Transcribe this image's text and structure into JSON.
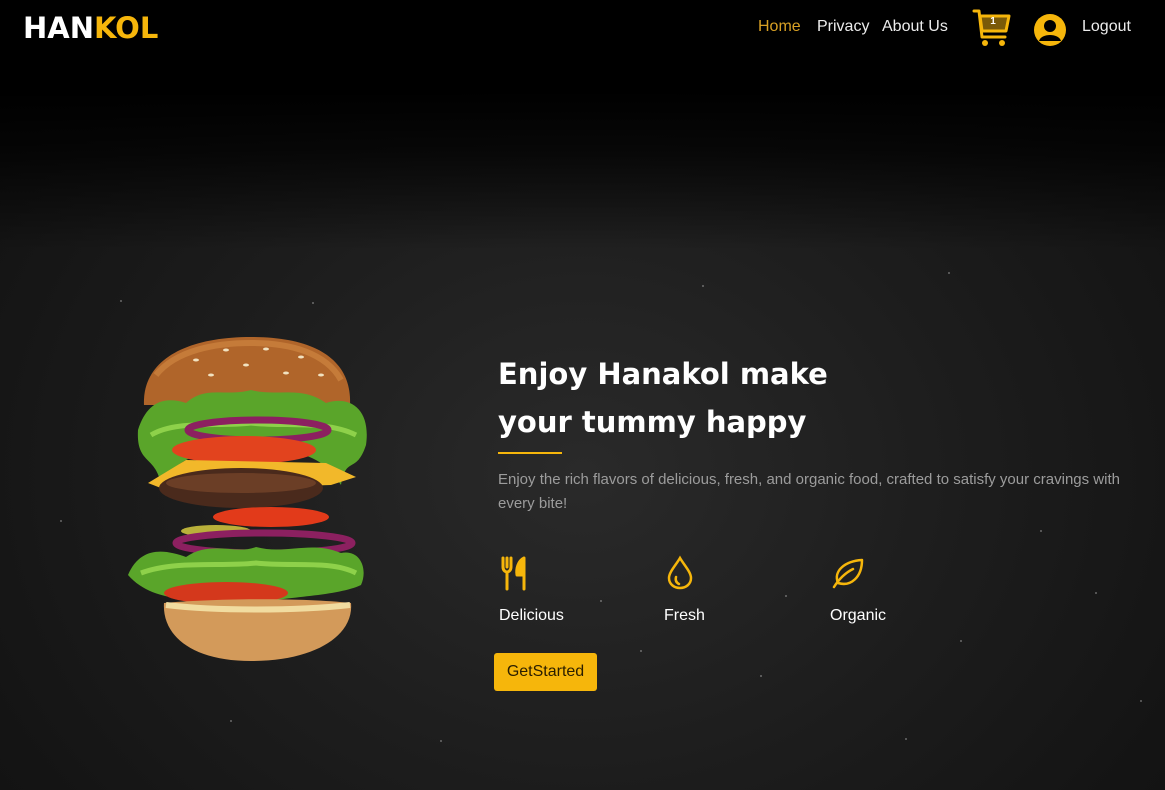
{
  "brand": {
    "part1": "HAN",
    "part2": "KOL"
  },
  "nav": {
    "links": [
      {
        "label": "Home",
        "active": true
      },
      {
        "label": "Privacy",
        "active": false
      },
      {
        "label": "About Us",
        "active": false
      }
    ],
    "cart_count": "1",
    "logout_label": "Logout"
  },
  "hero": {
    "title_line1": "Enjoy Hanakol make",
    "title_line2": "your tummy happy",
    "subtitle": "Enjoy the rich flavors of delicious, fresh, and organic food, crafted to satisfy your cravings with every bite!",
    "features": [
      {
        "label": "Delicious",
        "icon": "utensils-icon"
      },
      {
        "label": "Fresh",
        "icon": "droplet-icon"
      },
      {
        "label": "Organic",
        "icon": "leaf-icon"
      }
    ],
    "cta_label": "GetStarted"
  },
  "colors": {
    "accent": "#f6b60b",
    "nav_active": "#d8a024",
    "background": "#1a1a1a"
  }
}
